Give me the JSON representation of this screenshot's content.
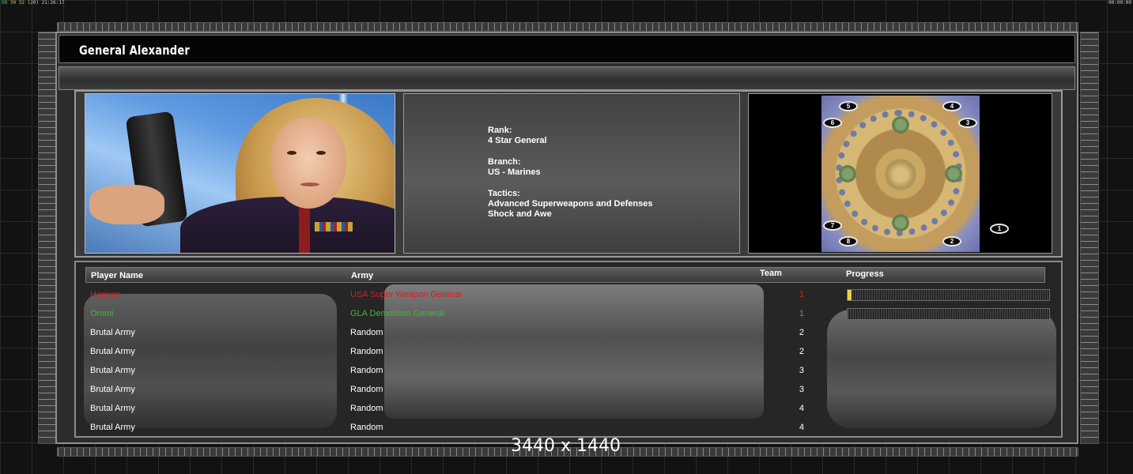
{
  "status_bar": {
    "left": {
      "a": "08",
      "b": "30",
      "c": "32",
      "d": "(20)",
      "e": "21:26:17"
    },
    "right": "00:00:00"
  },
  "general": {
    "name": "General Alexander"
  },
  "bio": {
    "rank_label": "Rank:",
    "rank_value": "4 Star General",
    "branch_label": "Branch:",
    "branch_value": "US - Marines",
    "tactics_label": "Tactics:",
    "tactics_line1": "Advanced Superweapons and Defenses",
    "tactics_line2": "Shock and Awe"
  },
  "map": {
    "spawns": [
      "1",
      "2",
      "3",
      "4",
      "5",
      "6",
      "7",
      "8"
    ]
  },
  "table": {
    "headers": {
      "name": "Player Name",
      "army": "Army",
      "team": "Team",
      "progress": "Progress"
    },
    "rows": [
      {
        "name": "Hansen",
        "army": "USA Super Weapon General",
        "team": "1",
        "color": "#d42020",
        "progress": 0.02
      },
      {
        "name": "Ommi",
        "army": "GLA Demolition General",
        "team": "1",
        "color": "#3fb83f",
        "progress": 0.0
      },
      {
        "name": "Brutal Army",
        "army": "Random",
        "team": "2",
        "color": "#ffffff"
      },
      {
        "name": "Brutal Army",
        "army": "Random",
        "team": "2",
        "color": "#ffffff"
      },
      {
        "name": "Brutal Army",
        "army": "Random",
        "team": "3",
        "color": "#ffffff"
      },
      {
        "name": "Brutal Army",
        "army": "Random",
        "team": "3",
        "color": "#ffffff"
      },
      {
        "name": "Brutal Army",
        "army": "Random",
        "team": "4",
        "color": "#ffffff"
      },
      {
        "name": "Brutal Army",
        "army": "Random",
        "team": "4",
        "color": "#ffffff"
      }
    ]
  },
  "overlay": {
    "resolution": "3440 x 1440"
  }
}
